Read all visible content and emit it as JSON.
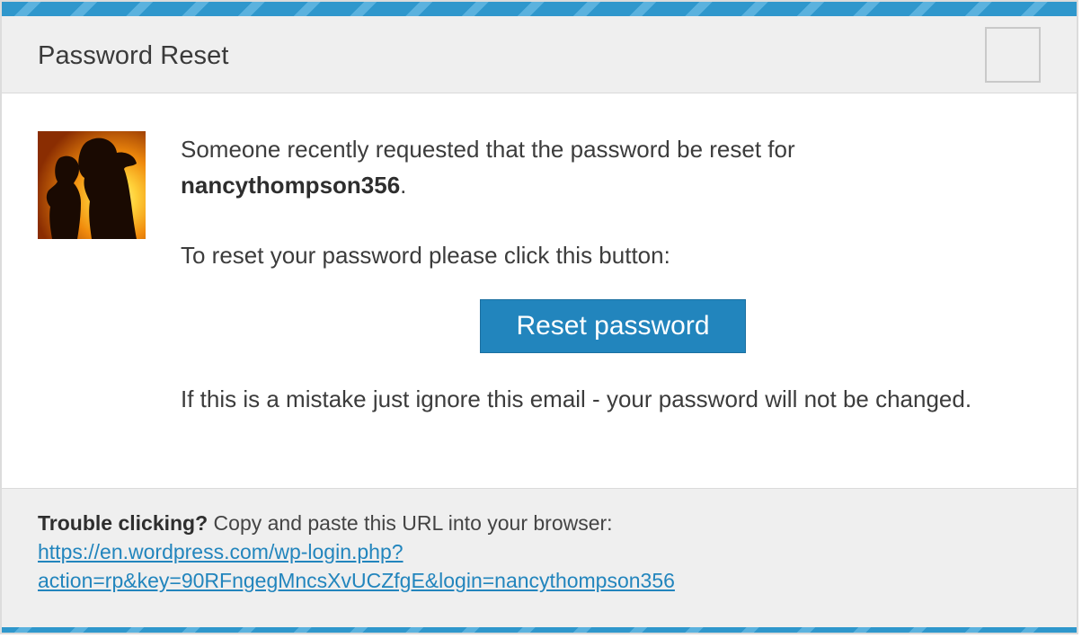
{
  "header": {
    "title": "Password Reset"
  },
  "message": {
    "line1": "Someone recently requested that the password be reset for",
    "username": "nancythompson356",
    "period": ".",
    "line2": "To reset your password please click this button:",
    "button_label": "Reset password",
    "line3": "If this is a mistake just ignore this email - your password will not be changed."
  },
  "footer": {
    "trouble_label": "Trouble clicking?",
    "instruction": " Copy and paste this URL into your browser:",
    "url_line1": "https://en.wordpress.com/wp-login.php?",
    "url_line2": "action=rp&key=90RFngegMncsXvUCZfgE&login=nancythompson356"
  },
  "colors": {
    "accent": "#2285bd",
    "stripe": "#2f97cc",
    "header_bg": "#efefef"
  },
  "icons": {
    "avatar": "avatar-silhouette-sunset",
    "logo": "logo-placeholder"
  }
}
